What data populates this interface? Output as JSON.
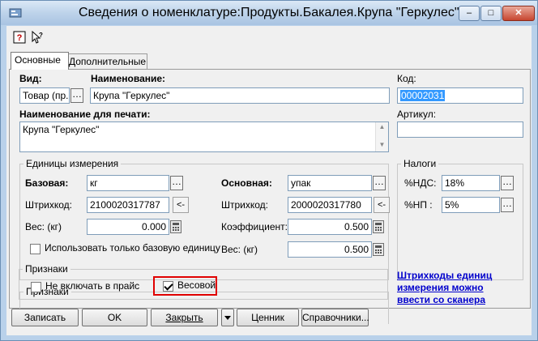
{
  "window": {
    "title": "Сведения о номенклатуре:Продукты.Бакалея.Крупа \"Геркулес\"",
    "controls": {
      "minimize": "–",
      "maximize": "□",
      "close": "✕"
    }
  },
  "toolbar": {
    "help_icon": "help-icon",
    "whats_this_icon": "whats-this-icon"
  },
  "tabs": [
    {
      "label": "Основные",
      "active": true
    },
    {
      "label": "Дополнительные",
      "active": false
    }
  ],
  "main": {
    "vid_label": "Вид:",
    "vid_value": "Товар (пр.",
    "name_label": "Наименование:",
    "name_value": "Крупа \"Геркулес\"",
    "kod_label": "Код:",
    "kod_value": "00002031",
    "print_name_label": "Наименование для печати:",
    "print_name_value": "Крупа \"Геркулес\"",
    "artikul_label": "Артикул:",
    "artikul_value": ""
  },
  "units": {
    "group_title": "Единицы измерения",
    "base_label": "Базовая:",
    "base_value": "кг",
    "barcode_label": "Штрихкод:",
    "base_barcode": "2100020317787",
    "arrow_label": "<-",
    "weight_label": "Вес: (кг)",
    "base_weight": "0.000",
    "only_base_label": "Использовать только базовую единицу",
    "main_label": "Основная:",
    "main_value": "упак",
    "main_barcode": "2000020317780",
    "coef_label": "Коэффициент:",
    "coef_value": "0.500",
    "main_weight_label": "Вес: (кг)",
    "main_weight": "0.500"
  },
  "taxes": {
    "group_title": "Налоги",
    "nds_label": "%НДС:",
    "nds_value": "18%",
    "np_label": "%НП :",
    "np_value": "5%"
  },
  "signs": {
    "group_title": "Признаки",
    "exclude_label": "Не включать в прайс",
    "exclude_checked": false,
    "weight_label": "Весовой",
    "weight_checked": true
  },
  "link_text": "Штрихкоды единиц измерения можно ввести со сканера",
  "buttons": {
    "save": "Записать",
    "ok": "OK",
    "close": "Закрыть",
    "price_tag": "Ценник",
    "references": "Справочники..."
  },
  "colors": {
    "highlight": "#e00000",
    "link": "#0000cc",
    "selection": "#3399ff"
  }
}
